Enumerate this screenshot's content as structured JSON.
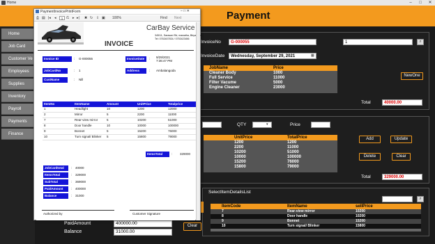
{
  "window": {
    "title": "Home",
    "controls": [
      "–",
      "□",
      "✕"
    ]
  },
  "header": {
    "title": "Payment"
  },
  "sidebar": {
    "items": [
      {
        "label": "Home"
      },
      {
        "label": "Job Card"
      },
      {
        "label": "Customer Ve"
      },
      {
        "label": "Employees"
      },
      {
        "label": "Supplies"
      },
      {
        "label": "Inventory"
      },
      {
        "label": "Payroll"
      },
      {
        "label": "Payments"
      },
      {
        "label": "Finance"
      }
    ]
  },
  "invoice_panel": {
    "invoice_no_label": "InvoiceNo",
    "invoice_no_value": "G-000055",
    "invoice_no_search_value": "1",
    "invoice_date_label": "InvoiceDate",
    "invoice_date_value": "Wednesday, September 29, 2021",
    "jobs_grid": {
      "headers": [
        "JobName",
        "Price"
      ],
      "rows": [
        [
          "Cleaner Body",
          "1000"
        ],
        [
          "Full Service",
          "11000"
        ],
        [
          "Filter Vacume",
          "5000"
        ],
        [
          "Engine Cleaner",
          "23000"
        ]
      ]
    },
    "new_one_label": "NewOne",
    "total_label": "Total",
    "total_value": "40000.00"
  },
  "items_panel": {
    "qty_label": "QTY",
    "price_label": "Price",
    "grid": {
      "headers": [
        "UnitPrice",
        "TotalPrice"
      ],
      "rows": [
        [
          "1200",
          "1200"
        ],
        [
          "2200",
          "11000"
        ],
        [
          "10200",
          "51000"
        ],
        [
          "10000",
          "100000"
        ],
        [
          "15200",
          "76000"
        ],
        [
          "15800",
          "79000"
        ]
      ]
    },
    "add_label": "Add",
    "update_label": "Update",
    "delete_label": "Delete",
    "clear_label": "Clear",
    "total_label": "Total",
    "total_value": "329000.00"
  },
  "selected_panel": {
    "title": "SelectItemDetailsList",
    "headers": [
      "ItemCode",
      "ItemName",
      "sellPrice"
    ],
    "rows": [
      [
        "7",
        "Rear-view mirror",
        "10200"
      ],
      [
        "8",
        "Door handle",
        "10200"
      ],
      [
        "9",
        "Bonnet",
        "15200"
      ],
      [
        "10",
        "Turn signal/ Blinker",
        "15800"
      ]
    ]
  },
  "payment": {
    "paid_amount_label": "PaidAmount",
    "paid_amount_value": "400000.00",
    "balance_label": "Balance",
    "balance_value": "31000.00",
    "clear_label": "Clear"
  },
  "preview": {
    "title": "PaymentInvoicePrintForm",
    "toolbar": {
      "page": "1",
      "of": "/1",
      "zoom": "100%",
      "find": "Find",
      "next": "Next"
    },
    "company": "CarBay Service",
    "address": "345/11, Sarasavi Rd, mawatha, Bbyagama",
    "phone": "Tel: 0763407834 / 0753423456",
    "heading": "INVOICE",
    "fields": {
      "invoice_id_label": "Invoice ID",
      "invoice_id_value": "G-000055",
      "invoice_date_label": "InvoiceDate",
      "invoice_date_value": "9/29/2021",
      "invoice_time_value": "7:36:47 PM",
      "jobcard_label": "JobCardNo",
      "jobcard_value": "1",
      "address_label": "Address",
      "address_value": "Ambalangoda",
      "cust_label": "CustName",
      "cust_value": "Nill"
    },
    "items": {
      "headers": [
        "ItemNo",
        "ItemName",
        "Amount",
        "UnitPrice",
        "Totalprice"
      ],
      "rows": [
        [
          "1",
          "Headlight",
          "10",
          "1200",
          "12000"
        ],
        [
          "2",
          "Mirror",
          "5",
          "2200",
          "11000"
        ],
        [
          "7",
          "Rear-view mirror",
          "5",
          "10200",
          "51000"
        ],
        [
          "8",
          "Door handle",
          "10",
          "10000",
          "100000"
        ],
        [
          "9",
          "Bonnet",
          "5",
          "15200",
          "76000"
        ],
        [
          "10",
          "Turn signal/ Blinker",
          "5",
          "15800",
          "79000"
        ]
      ]
    },
    "items_total_label": "ItemsTotal",
    "items_total_value": "329000",
    "summary": [
      {
        "label": "JobCardtotal",
        "value": "40000"
      },
      {
        "label": "ItemsTotal",
        "value": "329000"
      },
      {
        "label": "SubTotal",
        "value": "369000"
      },
      {
        "label": "PaidAmount",
        "value": "400000"
      },
      {
        "label": "Balance",
        "value": "31000"
      }
    ],
    "authorized_by": "Authorized by",
    "customer_signature": "Customer Signature"
  },
  "colors": {
    "accent": "#f39a1e",
    "preview_blue": "#1414d8",
    "panel_bg": "#1e1e1e"
  }
}
